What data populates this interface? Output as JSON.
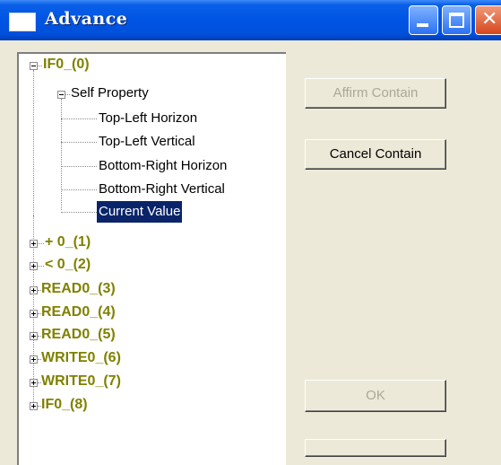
{
  "window": {
    "title": "Advance"
  },
  "tree": {
    "root": "IF0_(0)",
    "self_property": "Self Property",
    "properties": [
      "Top-Left Horizon",
      "Top-Left Vertical",
      "Bottom-Right Horizon",
      "Bottom-Right Vertical",
      "Current Value"
    ],
    "selected": "Current Value",
    "siblings": [
      "+ 0_(1)",
      "< 0_(2)",
      "READ0_(3)",
      "READ0_(4)",
      "READ0_(5)",
      "WRITE0_(6)",
      "WRITE0_(7)",
      "IF0_(8)"
    ]
  },
  "buttons": {
    "affirm_contain": "Affirm Contain",
    "cancel_contain": "Cancel Contain",
    "ok": "OK"
  },
  "colors": {
    "titlebar": "#0054e3",
    "node_text": "#808000",
    "selection": "#0a246a"
  }
}
